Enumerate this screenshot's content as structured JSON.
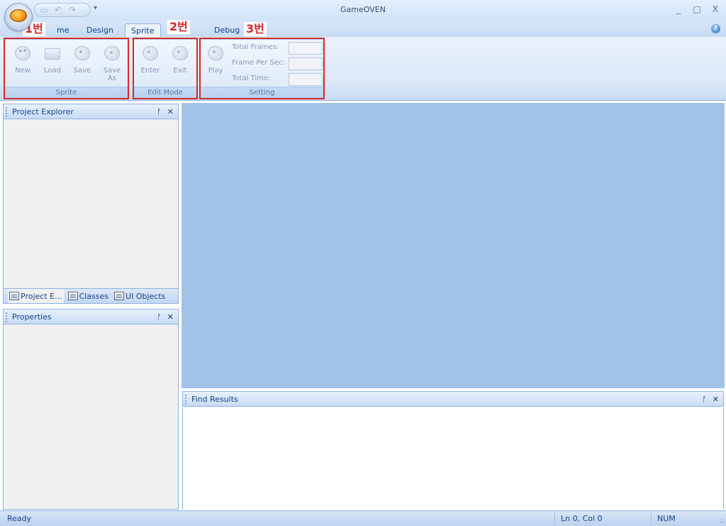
{
  "window": {
    "title": "GameOVEN",
    "controls": {
      "minimize": "_",
      "maximize": "□",
      "close": "X"
    },
    "qat_dropdown": "▾"
  },
  "ribbon_tabs": [
    {
      "label": "me",
      "active": false
    },
    {
      "label": "Design",
      "active": false
    },
    {
      "label": "Sprite",
      "active": true
    },
    {
      "label": "Debug",
      "active": false
    }
  ],
  "ribbon": {
    "groups": {
      "sprite": {
        "label": "Sprite",
        "buttons": {
          "new": "New",
          "load": "Load",
          "save": "Save",
          "save_as_1": "Save",
          "save_as_2": "As"
        }
      },
      "edit_mode": {
        "label": "Edit Mode",
        "buttons": {
          "enter": "Enter",
          "exit": "Exit"
        }
      },
      "setting": {
        "label": "Setting",
        "play": "Play",
        "total_frames_label": "Total Frames:",
        "frame_per_sec_label": "Frame Per Sec:",
        "total_time_label": "Total Time:",
        "total_frames_value": "",
        "frame_per_sec_value": "",
        "total_time_value": ""
      }
    },
    "annotations": {
      "one": "1번",
      "two": "2번",
      "three": "3번"
    },
    "annotation_color": "#d42a2a"
  },
  "panels": {
    "project_explorer": {
      "title": "Project Explorer",
      "pin": "ᚠ",
      "close": "✕"
    },
    "properties": {
      "title": "Properties",
      "pin": "ᚠ",
      "close": "✕"
    },
    "find_results": {
      "title": "Find Results",
      "pin": "ᚠ",
      "close": "✕"
    },
    "bottom_tabs": [
      {
        "label": "Project E...",
        "active": true
      },
      {
        "label": "Classes",
        "active": false
      },
      {
        "label": "UI Objects",
        "active": false
      }
    ]
  },
  "status_bar": {
    "ready": "Ready",
    "position": "Ln 0, Col 0",
    "num": "NUM"
  },
  "colors": {
    "workspace": "#a3c2e8",
    "ribbon_text": "#15428b",
    "panel_border": "#8db2e3"
  }
}
